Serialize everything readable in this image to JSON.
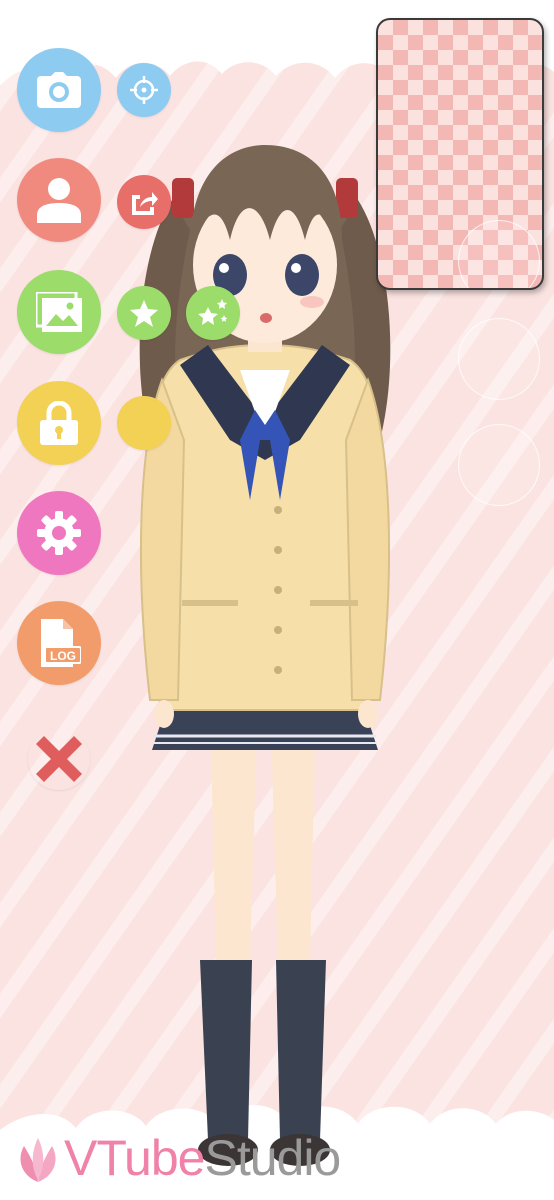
{
  "app": {
    "brand_primary": "VTube",
    "brand_secondary": "Studio"
  },
  "toolbar": {
    "camera": {
      "icon": "camera-icon",
      "color": "#8dcbf1"
    },
    "tracking": {
      "icon": "crosshair-icon",
      "color": "#8dcbf1"
    },
    "model": {
      "icon": "person-icon",
      "color": "#f08a7e"
    },
    "model_export": {
      "icon": "export-icon",
      "color": "#f08a7e"
    },
    "background": {
      "icon": "image-icon",
      "color": "#9bdc6a"
    },
    "item": {
      "icon": "star-icon",
      "color": "#9bdc6a"
    },
    "item_scene": {
      "icon": "stars-icon",
      "color": "#9bdc6a"
    },
    "lock": {
      "icon": "lock-icon",
      "color": "#f2d154"
    },
    "lock_extra": {
      "icon": "",
      "color": "#f2d154"
    },
    "settings": {
      "icon": "gear-icon",
      "color": "#ee77bf"
    },
    "log": {
      "icon": "log-icon",
      "label": "LOG",
      "color": "#f29c6c"
    },
    "close": {
      "icon": "close-icon",
      "color": "#e05d5d"
    }
  },
  "colors": {
    "background": "#fbe3e1",
    "checker": "#f4b8b4"
  }
}
